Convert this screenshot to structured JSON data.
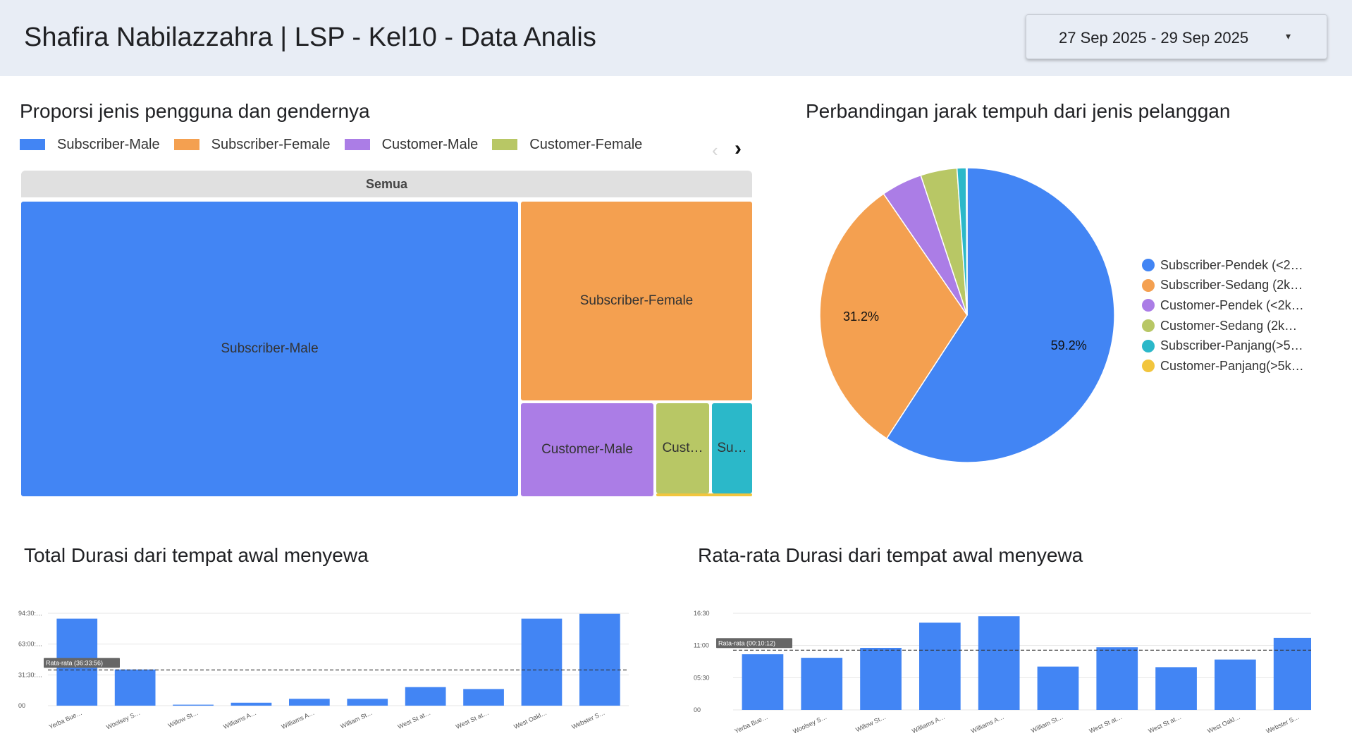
{
  "header": {
    "title": "Shafira Nabilazzahra | LSP - Kel10 - Data Analis",
    "date_range": "27 Sep 2025 - 29 Sep 2025",
    "caret": "▾"
  },
  "treemap": {
    "title": "Proporsi jenis pengguna dan gendernya",
    "nav_prev": "‹",
    "nav_next": "›",
    "root_label": "Semua"
  },
  "pie": {
    "title": "Perbandingan jarak tempuh dari jenis pelanggan"
  },
  "total_chart": {
    "title": "Total Durasi dari tempat awal menyewa"
  },
  "avg_chart": {
    "title": "Rata-rata Durasi dari tempat awal menyewa"
  },
  "colors": {
    "blue": "#4285f4",
    "orange": "#f4a050",
    "purple": "#ab7de6",
    "olive": "#b8c765",
    "teal": "#2bb8c9",
    "yellow": "#f2c53d",
    "root_gray": "#e0e0e0",
    "header_bg": "#e8edf5"
  },
  "chart_data": [
    {
      "type": "treemap",
      "title": "Proporsi jenis pengguna dan gendernya",
      "root": "Semua",
      "legend": [
        "Subscriber-Male",
        "Subscriber-Female",
        "Customer-Male",
        "Customer-Female"
      ],
      "nodes": [
        {
          "name": "Subscriber-Male",
          "display": "Subscriber-Male",
          "share": 0.6,
          "color": "#4285f4"
        },
        {
          "name": "Subscriber-Female",
          "display": "Subscriber-Female",
          "share": 0.24,
          "color": "#f4a050"
        },
        {
          "name": "Customer-Male",
          "display": "Customer-Male",
          "share": 0.09,
          "color": "#ab7de6"
        },
        {
          "name": "Customer-Female",
          "display": "Cust…",
          "share": 0.04,
          "color": "#b8c765"
        },
        {
          "name": "Subscriber",
          "display": "Su…",
          "share": 0.03,
          "color": "#2bb8c9"
        },
        {
          "name": "",
          "display": "",
          "share": 0.002,
          "color": "#f2c53d"
        }
      ]
    },
    {
      "type": "pie",
      "title": "Perbandingan jarak tempuh dari jenis pelanggan",
      "legend_position": "right",
      "slices": [
        {
          "name": "Subscriber-Pendek (<2…",
          "value": 59.2,
          "label": "59.2%",
          "color": "#4285f4"
        },
        {
          "name": "Subscriber-Sedang (2k…",
          "value": 31.2,
          "label": "31.2%",
          "color": "#f4a050"
        },
        {
          "name": "Customer-Pendek (<2k…",
          "value": 4.5,
          "label": "",
          "color": "#ab7de6"
        },
        {
          "name": "Customer-Sedang (2k…",
          "value": 4.0,
          "label": "",
          "color": "#b8c765"
        },
        {
          "name": "Subscriber-Panjang(>5…",
          "value": 1.0,
          "label": "",
          "color": "#2bb8c9"
        },
        {
          "name": "Customer-Panjang(>5k…",
          "value": 0.1,
          "label": "",
          "color": "#f2c53d"
        }
      ]
    },
    {
      "type": "bar",
      "title": "Total Durasi dari tempat awal menyewa",
      "categories": [
        "Yerba Bue…",
        "Woolsey S…",
        "Willow St…",
        "Williams A…",
        "Williams A…",
        "William St…",
        "West St at…",
        "West St at…",
        "West Oakl…",
        "Webster S…"
      ],
      "values": [
        89,
        37,
        1,
        3,
        7,
        7,
        19,
        17,
        89,
        94
      ],
      "y_ticks": [
        "00",
        "31:30:…",
        "63:00:…",
        "94:30:…"
      ],
      "y_tick_values": [
        0,
        31.5,
        63,
        94.5
      ],
      "ylim": [
        0,
        94.5
      ],
      "reference_line": {
        "label": "Rata-rata (36:33:56)",
        "value": 36.57
      },
      "grid": true
    },
    {
      "type": "bar",
      "title": "Rata-rata Durasi dari tempat awal menyewa",
      "categories": [
        "Yerba Bue…",
        "Woolsey S…",
        "Willow St…",
        "Williams A…",
        "Williams A…",
        "William St…",
        "West St at…",
        "West St at…",
        "West Oakl…",
        "Webster S…"
      ],
      "values": [
        9.5,
        8.9,
        10.6,
        14.9,
        16.0,
        7.4,
        10.7,
        7.3,
        8.6,
        12.3
      ],
      "y_ticks": [
        "00",
        "05:30",
        "11:00",
        "16:30"
      ],
      "y_tick_values": [
        0,
        5.5,
        11,
        16.5
      ],
      "ylim": [
        0,
        16.5
      ],
      "reference_line": {
        "label": "Rata-rata (00:10:12)",
        "value": 10.2
      },
      "grid": true
    }
  ]
}
